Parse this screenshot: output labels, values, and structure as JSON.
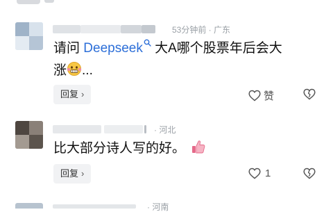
{
  "comments": [
    {
      "meta": "53分钟前 · 广东",
      "text_prefix": "请问 ",
      "link_text": "Deepseek",
      "text_suffix": " 大A哪个股票年后会大",
      "text_line2": "涨",
      "text_line2_tail": "...",
      "reply_label": "回复",
      "like_label": "赞"
    },
    {
      "meta": "· 河北",
      "text": "比大部分诗人写的好。",
      "reply_label": "回复",
      "like_count": "1"
    },
    {
      "meta": "· 河南"
    }
  ],
  "colors": {
    "link": "#2d6fd8",
    "meta": "#9aa0a6",
    "reply_bg": "#f1f2f4"
  },
  "icons": [
    "search-icon",
    "grimace-emoji-icon",
    "thumbs-up-emoji-icon",
    "heart-icon",
    "broken-heart-icon",
    "chevron-right-icon"
  ]
}
